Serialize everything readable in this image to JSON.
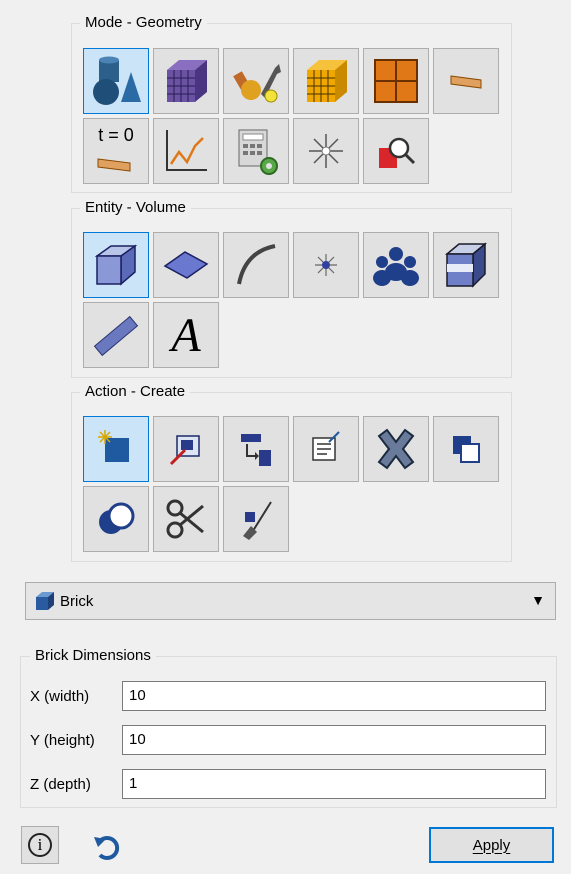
{
  "mode_group": {
    "title": "Mode - Geometry"
  },
  "mode_buttons": {
    "time_label": "t = 0"
  },
  "entity_group": {
    "title": "Entity - Volume"
  },
  "entity_buttons": {
    "text_glyph": "A"
  },
  "action_group": {
    "title": "Action - Create"
  },
  "shape_select": {
    "value": "Brick"
  },
  "dimensions": {
    "title": "Brick Dimensions",
    "x_label": "X (width)",
    "x_value": "10",
    "y_label": "Y (height)",
    "y_value": "10",
    "z_label": "Z (depth)",
    "z_value": "1"
  },
  "footer": {
    "info_glyph": "i",
    "apply_label": "Apply"
  }
}
